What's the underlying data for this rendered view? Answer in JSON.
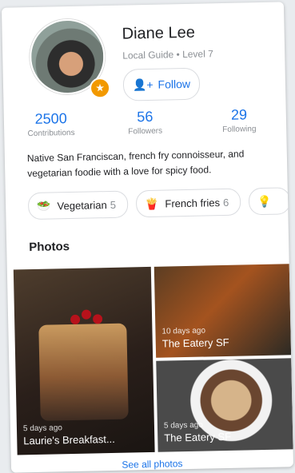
{
  "profile": {
    "name": "Diane Lee",
    "level": "Local Guide • Level 7",
    "follow_label": "Follow"
  },
  "stats": [
    {
      "value": "2500",
      "label": "Contributions"
    },
    {
      "value": "56",
      "label": "Followers"
    },
    {
      "value": "29",
      "label": "Following"
    }
  ],
  "bio": "Native San Franciscan, french fry connoisseur, and vegetarian foodie with a love for spicy food.",
  "chips": [
    {
      "label": "Vegetarian",
      "count": "5",
      "icon": "salad-icon"
    },
    {
      "label": "French fries",
      "count": "6",
      "icon": "fries-icon"
    }
  ],
  "photos": {
    "title": "Photos",
    "items": [
      {
        "time": "5 days ago",
        "place": "Laurie's Breakfast..."
      },
      {
        "time": "10 days ago",
        "place": "The Eatery SF"
      },
      {
        "time": "5 days ago",
        "place": "The Eatery SF"
      }
    ],
    "see_all": "See all photos"
  },
  "colors": {
    "accent": "#1a73e8",
    "badge": "#f29900"
  }
}
